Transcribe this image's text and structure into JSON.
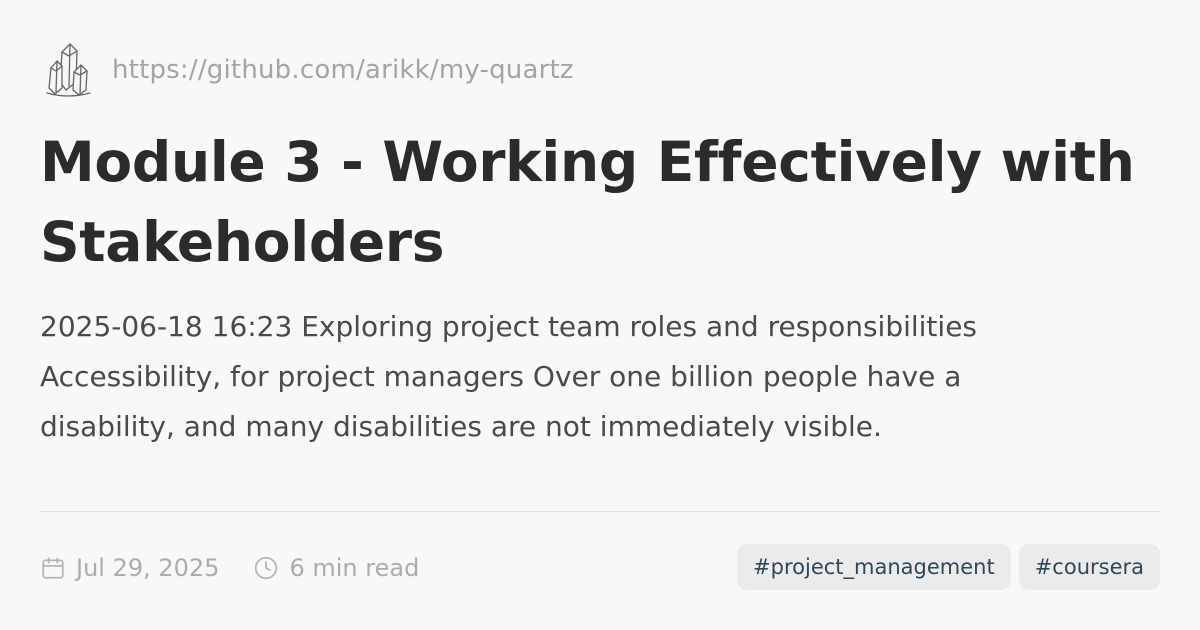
{
  "site": {
    "url": "https://github.com/arikk/my-quartz",
    "logo_icon": "crystal-logo-icon"
  },
  "page": {
    "title": "Module 3 - Working Effectively with Stakeholders",
    "description": "2025-06-18 16:23 Exploring project team roles and responsibilities Accessibility, for project managers Over one billion people have a disability, and many disabilities are not immediately visible."
  },
  "meta": {
    "date": "Jul 29, 2025",
    "date_icon": "calendar-icon",
    "reading_time": "6 min read",
    "reading_time_icon": "clock-icon"
  },
  "tags": [
    {
      "label": "#project_management"
    },
    {
      "label": "#coursera"
    }
  ],
  "colors": {
    "background": "#f8f8f9",
    "title": "#2b2b2b",
    "description": "#4a4a4e",
    "muted": "#a4a4a8",
    "tag_background": "#ebebed",
    "tag_text": "#2f4758"
  }
}
